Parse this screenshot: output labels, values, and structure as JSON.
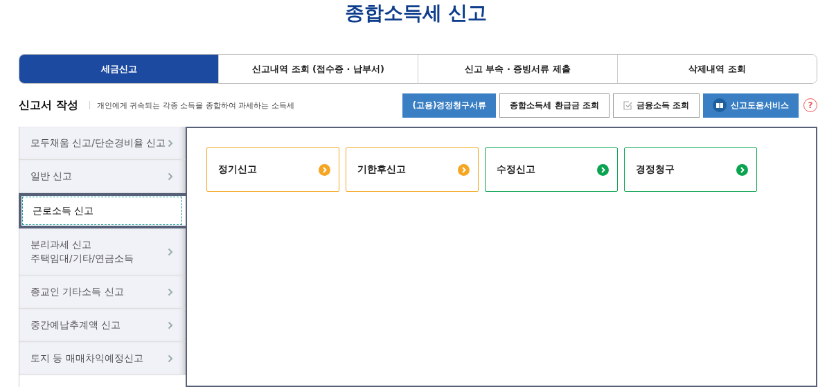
{
  "title": "종합소득세 신고",
  "tabs": [
    {
      "label": "세금신고",
      "selected": true
    },
    {
      "label": "신고내역 조회 (접수증 · 납부서)",
      "selected": false
    },
    {
      "label": "신고 부속 · 증빙서류 제출",
      "selected": false
    },
    {
      "label": "삭제내역 조회",
      "selected": false
    }
  ],
  "section": {
    "heading": "신고서 작성",
    "description": "개인에게 귀속되는 각종 소득을 종합하여 과세하는 소득세"
  },
  "actions": [
    {
      "label": "(고용)경정청구서류",
      "kind": "primary"
    },
    {
      "label": "종합소득세 환급금 조회",
      "kind": "default"
    },
    {
      "label": "금융소득 조회",
      "kind": "check"
    },
    {
      "label": "신고도움서비스",
      "kind": "book"
    },
    {
      "label": "?",
      "kind": "help"
    }
  ],
  "sidebar": {
    "items": [
      {
        "lines": [
          "모두채움 신고/단순경비율 신고"
        ],
        "selected": false
      },
      {
        "lines": [
          "일반 신고"
        ],
        "selected": false
      },
      {
        "lines": [
          "근로소득 신고"
        ],
        "selected": true
      },
      {
        "lines": [
          "분리과세 신고",
          "주택임대/기타/연금소득"
        ],
        "selected": false
      },
      {
        "lines": [
          "종교인 기타소득 신고"
        ],
        "selected": false
      },
      {
        "lines": [
          "중간예납추계액 신고"
        ],
        "selected": false
      },
      {
        "lines": [
          "토지 등 매매차익예정신고"
        ],
        "selected": false
      }
    ]
  },
  "options": [
    {
      "label": "정기신고",
      "color": "#f5a623"
    },
    {
      "label": "기한후신고",
      "color": "#f5a623"
    },
    {
      "label": "수정신고",
      "color": "#0aa34f"
    },
    {
      "label": "경정청구",
      "color": "#0aa34f"
    }
  ]
}
